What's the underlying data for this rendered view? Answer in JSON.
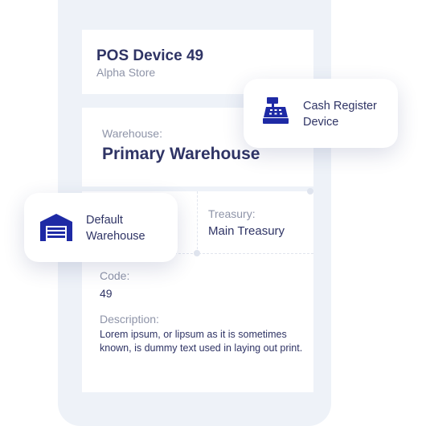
{
  "device": {
    "name": "POS Device 49",
    "store": "Alpha Store"
  },
  "warehouse": {
    "label": "Warehouse:",
    "value": "Primary Warehouse"
  },
  "treasury": {
    "label": "Treasury:",
    "value": "Main Treasury"
  },
  "code": {
    "label": "Code:",
    "value": "49"
  },
  "description": {
    "label": "Description:",
    "value": "Lorem ipsum, or lipsum as it is sometimes known, is dummy text used in laying out print."
  },
  "badges": {
    "register": {
      "icon": "cash-register-icon",
      "line1": "Cash Register",
      "line2": "Device"
    },
    "warehouse": {
      "icon": "warehouse-icon",
      "line1": "Default",
      "line2": "Warehouse"
    }
  },
  "colors": {
    "accent": "#1e2aa5",
    "heading": "#2f3465",
    "muted": "#8e94a8",
    "phone_bg": "#eef2f8"
  }
}
